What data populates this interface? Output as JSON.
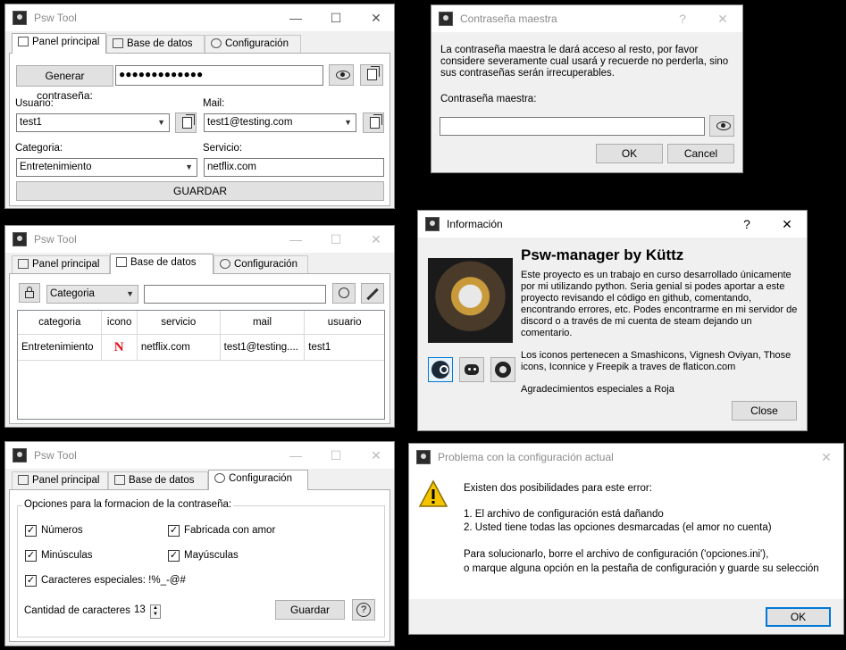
{
  "main_window": {
    "title": "Psw Tool",
    "tabs": [
      "Panel principal",
      "Base de datos",
      "Configuración"
    ],
    "generate_label": "Generar contraseña:",
    "password_value": "●●●●●●●●●●●●●",
    "user_label": "Usuario:",
    "user_value": "test1",
    "mail_label": "Mail:",
    "mail_value": "test1@testing.com",
    "category_label": "Categoria:",
    "category_value": "Entretenimiento",
    "service_label": "Servicio:",
    "service_value": "netflix.com",
    "save_label": "GUARDAR"
  },
  "db_window": {
    "title": "Psw Tool",
    "tabs": [
      "Panel principal",
      "Base de datos",
      "Configuración"
    ],
    "filter_value": "Categoria",
    "search_value": "",
    "columns": [
      "categoria",
      "icono",
      "servicio",
      "mail",
      "usuario"
    ],
    "rows": [
      {
        "categoria": "Entretenimiento",
        "icono": "N",
        "servicio": "netflix.com",
        "mail": "test1@testing....",
        "usuario": "test1"
      }
    ]
  },
  "config_window": {
    "title": "Psw Tool",
    "tabs": [
      "Panel principal",
      "Base de datos",
      "Configuración"
    ],
    "group_title": "Opciones para la formacion de la contraseña:",
    "opt_numbers": "Números",
    "opt_love": "Fabricada con amor",
    "opt_lower": "Minúsculas",
    "opt_upper": "Mayúsculas",
    "opt_special": "Caracteres especiales: !%_-@#",
    "length_label": "Cantidad de caracteres:",
    "length_value": "13",
    "save_label": "Guardar",
    "help_label": "?"
  },
  "master_dialog": {
    "title": "Contraseña maestra",
    "message": "La contraseña maestra le dará acceso al resto, por favor considere severamente cual usará y recuerde no perderla, sino sus contraseñas serán irrecuperables.",
    "field_label": "Contraseña maestra:",
    "ok_label": "OK",
    "cancel_label": "Cancel",
    "help_glyph": "?",
    "close_glyph": "✕"
  },
  "info_dialog": {
    "title": "Información",
    "heading": "Psw-manager by Küttz",
    "body": "Este proyecto es un trabajo en curso desarrollado únicamente por mi utilizando python. Seria genial si podes aportar a este proyecto revisando el código en github, comentando, encontrando errores, etc. Podes encontrarme en mi servidor de discord o a través de mi cuenta de steam dejando un comentario.",
    "icons_credit": "Los iconos pertenecen a Smashicons, Vignesh Oviyan, Those icons, Iconnice y Freepik a traves de flaticon.com",
    "thanks": "Agradecimientos especiales a Roja",
    "close_label": "Close",
    "help_glyph": "?",
    "close_glyph": "✕"
  },
  "error_dialog": {
    "title": "Problema con la configuración actual",
    "intro": "Existen dos posibilidades para este error:",
    "cause1": "1. El archivo de configuración está dañando",
    "cause2": "2. Usted tiene todas las opciones desmarcadas (el amor no cuenta)",
    "solution1": "Para solucionarlo, borre el archivo de configuración ('opciones.ini'),",
    "solution2": "o marque alguna opción en la pestaña de configuración y guarde su selección",
    "ok_label": "OK",
    "close_glyph": "✕"
  },
  "colors": {
    "accent": "#0078d7",
    "netflix": "#e50914",
    "warning": "#f5c400"
  }
}
